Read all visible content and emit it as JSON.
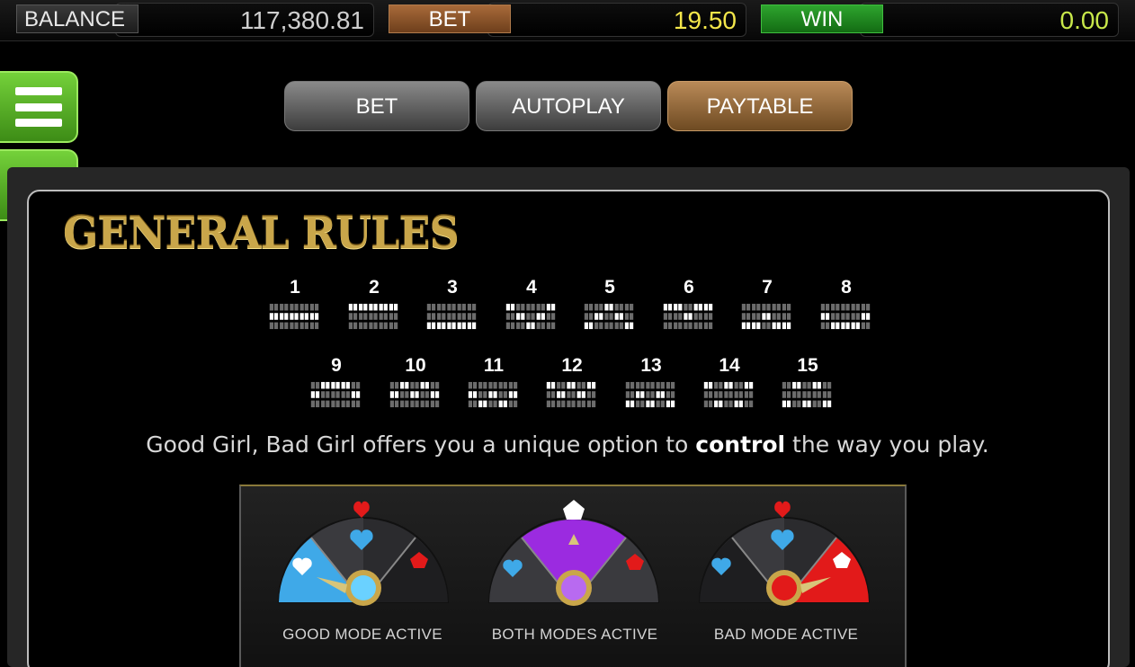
{
  "topbar": {
    "balance_label": "BALANCE",
    "balance_value": "117,380.81",
    "bet_label": "BET",
    "bet_value": "19.50",
    "win_label": "WIN",
    "win_value": "0.00"
  },
  "side": {
    "menu_icon": "hamburger-icon",
    "back_icon": "back-arrow-icon"
  },
  "tabs": [
    {
      "label": "BET",
      "active": false
    },
    {
      "label": "AUTOPLAY",
      "active": false
    },
    {
      "label": "PAYTABLE",
      "active": true
    }
  ],
  "rules": {
    "title": "GENERAL RULES",
    "paylines": [
      {
        "num": "1",
        "rows": [
          1,
          1,
          1
        ]
      },
      {
        "num": "2",
        "rows": [
          0,
          0,
          0
        ]
      },
      {
        "num": "3",
        "rows": [
          2,
          2,
          2
        ]
      },
      {
        "num": "4",
        "rows": [
          0,
          1,
          2
        ]
      },
      {
        "num": "5",
        "rows": [
          2,
          1,
          0
        ]
      },
      {
        "num": "6",
        "rows": [
          0,
          0,
          1
        ]
      },
      {
        "num": "7",
        "rows": [
          2,
          2,
          1
        ]
      },
      {
        "num": "8",
        "rows": [
          1,
          2,
          2
        ]
      },
      {
        "num": "9",
        "rows": [
          1,
          0,
          0
        ]
      },
      {
        "num": "10",
        "rows": [
          1,
          0,
          1
        ]
      },
      {
        "num": "11",
        "rows": [
          1,
          2,
          1
        ]
      },
      {
        "num": "12",
        "rows": [
          0,
          1,
          0
        ]
      },
      {
        "num": "13",
        "rows": [
          2,
          1,
          2
        ]
      },
      {
        "num": "14",
        "rows": [
          0,
          2,
          0
        ]
      },
      {
        "num": "15",
        "rows": [
          2,
          0,
          2
        ]
      }
    ],
    "desc_before": "Good Girl, Bad Girl offers you a unique option to ",
    "desc_bold": "control",
    "desc_after": " the way you play."
  },
  "modes": [
    {
      "label": "GOOD MODE ACTIVE",
      "icon": "good-mode-dial-icon"
    },
    {
      "label": "BOTH MODES ACTIVE",
      "icon": "both-modes-dial-icon"
    },
    {
      "label": "BAD MODE ACTIVE",
      "icon": "bad-mode-dial-icon"
    }
  ],
  "colors": {
    "bet_value": "#f3e64a",
    "win_value": "#c8e84a",
    "green_button": "#5cb82a",
    "active_tab": "#a2743f",
    "title_gold": "#c9a64a",
    "good_blue": "#3fa9e8",
    "bad_red": "#e21a1a",
    "both_purple": "#9b2be0"
  }
}
